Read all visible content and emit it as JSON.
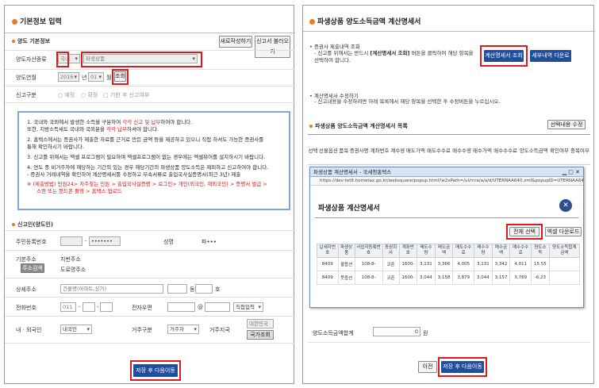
{
  "left": {
    "title": "기본정보 입력",
    "section1": "양도 기본정보",
    "btn_new": "새로작성하기",
    "btn_load": "신고서 불러오기",
    "asset_label": "양도자산종류",
    "asset_value1": "국내",
    "asset_value2": "파생상품",
    "period_label": "양도연월",
    "year": "2016",
    "year_unit": "년",
    "month": "01",
    "month_unit": "월",
    "lookup_btn": "조회",
    "report_label": "신고구분",
    "report_opt1": "예정",
    "report_opt2": "확정",
    "report_opt3": "기한 후 신고여부",
    "notice": [
      {
        "n": "1. ",
        "t1": "국내와 국외에서 발생한 소득을 구분하여 ",
        "r": "각각 신고 및 납부",
        "t2": "하여야 합니다."
      },
      {
        "n": "",
        "t1": "   또한, 지방소득세도 국내와 국외분을 ",
        "r": "각각 납부",
        "t2": "하셔야 합니다."
      },
      {
        "n": "2. ",
        "t1": "홈택스에서는 증권사가 제출한 자료를 근거로 만든 금액 등을 제공하고 있으니 직접 하셔도 가능한 증권사를",
        "r": "",
        "t2": ""
      },
      {
        "n": "",
        "t1": "   통해 확인하시기 바랍니다.",
        "r": "",
        "t2": ""
      },
      {
        "n": "3. ",
        "t1": "신고를 위해서는 엑셀 프로그램이 필요하며 엑셀프로그램이 없는 경우에는 엑셀뷰어를 설치하시기 바랍니다.",
        "r": "",
        "t2": ""
      },
      {
        "n": "4. ",
        "t1": "연도 중 비거주자에 해당하는 기간의 있는 경우 해당기간의 파생상품 양도소득은 제외하고 신고하여야 합니다.",
        "r": "",
        "t2": ""
      },
      {
        "n": "",
        "t1": "   - 증권사 거래내역을 확인하여 계산명세서를 수정하고 부속서류로 출입국사실증명서(최근 3년) 제출",
        "r": "",
        "t2": ""
      }
    ],
    "notice_extra1": "※ (제출방법) 민원24> 자주찾는 민원 > 출입국사실증명 > 로그인> 개인(외국인, 재외국민) > 증명서 발급 >",
    "notice_extra2": "스캔 또는 핸드폰 촬영 > 홈택스 업로드",
    "section2": "신고인(양도인)",
    "rrn_label": "주민등록번호",
    "rrn_suffix": "•••••••",
    "name_label": "성명",
    "name_value": "파•••",
    "addr_label": "기본주소",
    "addr_btn": "주소검색",
    "addr_line1": "지번주소",
    "addr_line2": "도로명주소",
    "detail_label": "상세주소",
    "detail_ph": "건물명(아파트,상가)",
    "dong_unit": "동",
    "ho_unit": "호",
    "phone_label": "전화번호",
    "phone1": "011",
    "mail_label": "전자우편",
    "mail_at": "@",
    "mail_sel": "직접입력",
    "domestic_label": "내 · 외국인",
    "domestic_value": "내국인",
    "residence_label": "거주구분",
    "residence_value": "거주자",
    "country_label": "거주지국",
    "country_value": "대한민국",
    "country_btn": "국가조회",
    "save_btn": "저장 후 다음이동"
  },
  "right": {
    "title": "파생상품 양도소득금액 계산명세서",
    "b1_head": "증권사 제출내역 조회",
    "b1_text1a": "- 신고를 위해서는 반드시 ",
    "b1_text1b": "[계산명세서 조회]",
    "b1_text1c": " 버튼을 클릭하여 해당 항목을",
    "b1_text2": "  선택하여 합니다.",
    "btn_calc": "계산명세서 조회",
    "btn_down": "세부내역 다운로드",
    "b2_head": "계산명세서 수정하기",
    "b2_text": "- 신고내용을 수정하려면 아래 목록에서 해당 항목을 선택한 후 수정버튼을 누르십시오.",
    "list_title": "파생상품 양도소득금액 계산명세서 목록",
    "btn_edit": "선택내용 수정",
    "cols": [
      "선택",
      "선물옵션",
      "품목",
      "증권사명",
      "계좌번호",
      "계수량",
      "매도가액",
      "매도수수료",
      "매수수량",
      "매수가액",
      "매수수수료",
      "양도소득금액",
      "확인여부",
      "중복여부"
    ],
    "total_label": "양도소득금액합계",
    "total_value": "0",
    "total_unit": "원",
    "btn_prev": "이전",
    "btn_save": "저장 후 다음이동"
  },
  "popup": {
    "window_title": "파생상품 계산명세서 - 국세청홈택스",
    "url": "https://dev-tetlt.hometax.go.kr/websquare/popup.html?w2xPath=/ui/rn/a/a/a/d/UTERNAA640.xml&popupID=UTERNAA640&w2xHome=/ui/rn/z/bsx...",
    "title": "파생상품 계산명세서",
    "btn_all": "전체 선택",
    "btn_excel": "엑셀 다운로드",
    "cols": [
      "납세자번호",
      "파생상품",
      "사업자등록번호",
      "증권회사",
      "계좌번호",
      "매도수량",
      "매도금액",
      "매도수수료",
      "매수수량",
      "매수금액",
      "매수수수료",
      "양도소득",
      "양도소득합계금액"
    ],
    "rows": [
      [
        "8409",
        "콜옵션",
        "108-8-",
        "코픈",
        "1600-",
        "3,131",
        "3,366",
        "4,005",
        "3,131",
        "3,342",
        "4,011",
        "15.55",
        ""
      ],
      [
        "8409",
        "풋옵션",
        "108-8-",
        "코픈",
        "1600-",
        "3,044",
        "3,158",
        "3,879",
        "3,044",
        "3,157",
        "3,769",
        "-6,23",
        ""
      ]
    ]
  },
  "colors": {
    "accent": "#e87b2a",
    "red_box": "#e0191f",
    "blue_btn": "#1f4e9c",
    "notice_border": "#7da7d9"
  }
}
